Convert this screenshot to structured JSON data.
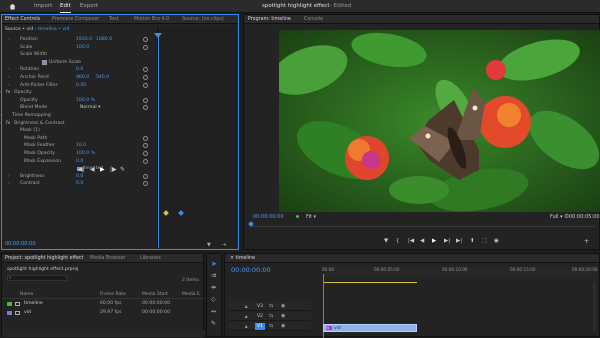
{
  "header": {
    "home_icon": "home-icon",
    "nav": [
      "Import",
      "Edit",
      "Export"
    ],
    "active": "Edit",
    "project_title": "spotlight highlight effect",
    "status": "- Edited"
  },
  "effect_controls": {
    "tabs": [
      "Effect Controls",
      "Premiere Composer",
      "Text",
      "Motion Bro 4.0",
      "Source: (no clips)"
    ],
    "source_label": "Source • vid",
    "sequence_label": "timeline • vid",
    "rows": [
      {
        "label": "Position",
        "value": "1920.0",
        "value2": "1080.0"
      },
      {
        "label": "Scale",
        "value": "100.0"
      },
      {
        "label": "Scale Width",
        "value": ""
      },
      {
        "label": "Uniform Scale",
        "value": ""
      },
      {
        "label": "Rotation",
        "value": "0.0"
      },
      {
        "label": "Anchor Point",
        "value": "960.0",
        "value2": "540.0"
      },
      {
        "label": "Anti-flicker Filter",
        "value": "0.00"
      },
      {
        "label": "Opacity",
        "value": ""
      },
      {
        "label": "Opacity",
        "value": "100.0 %"
      },
      {
        "label": "Blend Mode",
        "value": "Normal"
      },
      {
        "label": "Time Remapping",
        "value": ""
      },
      {
        "label": "Brightness & Contrast",
        "value": ""
      },
      {
        "label": "Mask (1)",
        "value": ""
      },
      {
        "label": "Mask Path",
        "value": ""
      },
      {
        "label": "Mask Feather",
        "value": "10.0"
      },
      {
        "label": "Mask Opacity",
        "value": "100.0 %"
      },
      {
        "label": "Mask Expansion",
        "value": "0.0"
      },
      {
        "label": "Inverted",
        "value": ""
      },
      {
        "label": "Brightness",
        "value": "0.0"
      },
      {
        "label": "Contrast",
        "value": "0.0"
      }
    ],
    "timecode": "00:00:00:00"
  },
  "program": {
    "tabs": [
      "Program: timeline",
      "Console"
    ],
    "timecode": "00:00:00:00",
    "fit": "Fit",
    "quality": "Full",
    "duration": "00:00:05:00"
  },
  "project": {
    "tabs": [
      "Project: spotlight highlight effect",
      "Media Browser",
      "Libraries"
    ],
    "file": "spotlight highlight effect.prproj",
    "items_count": "2 Items",
    "columns": [
      "Name",
      "Frame Rate",
      "Media Start",
      "Media E"
    ],
    "items": [
      {
        "name": "timeline",
        "fps": "60,00 fps",
        "start": "00:00:00:00",
        "color": "#3fbf3f"
      },
      {
        "name": "vid",
        "fps": "29,97 fps",
        "start": "00:00:00:00",
        "color": "#7a7ad8"
      }
    ]
  },
  "timeline": {
    "tabs": [
      "timeline"
    ],
    "timecode": "00:00:00:00",
    "ruler": [
      "00:00",
      "00:00:05:00",
      "00:00:10:00",
      "00:00:15:00",
      "00:00:20:00"
    ],
    "tracks": [
      "V3",
      "V2",
      "V1"
    ],
    "clip_label": "vid"
  },
  "colors": {
    "accent": "#3c8cf0",
    "clip": "#8fb4ea",
    "keyframe_yellow": "#d0c24a"
  }
}
